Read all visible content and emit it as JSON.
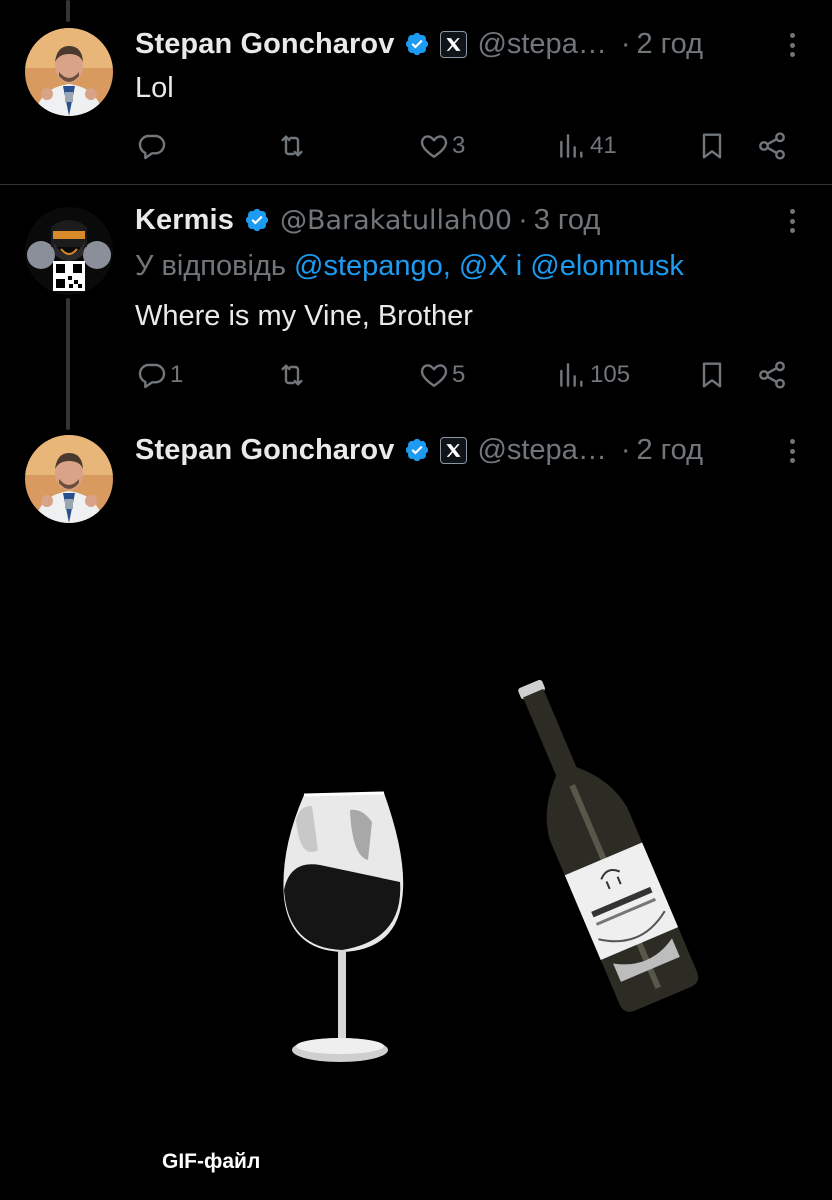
{
  "tweets": [
    {
      "name": "Stepan Goncharov",
      "handle": "@stepa…",
      "time": "2 год",
      "text": "Lol",
      "replies": "",
      "reposts": "",
      "likes": "3",
      "views": "41",
      "has_affiliate_badge": true
    },
    {
      "name": "Kermis",
      "handle": "@Barakatullah00",
      "time": "3 год",
      "reply_prefix": "У відповідь",
      "reply_mentions": "@stepango, @X",
      "reply_joiner": "i",
      "reply_last": "@elonmusk",
      "text": "Where is my Vine, Brother",
      "replies": "1",
      "reposts": "",
      "likes": "5",
      "views": "105"
    },
    {
      "name": "Stepan Goncharov",
      "handle": "@stepa…",
      "time": "2 год",
      "media_badge": "GIF-файл",
      "has_affiliate_badge": true
    }
  ],
  "separator": "·",
  "icons": {
    "verified": "verified-badge-icon",
    "affiliate": "x-affiliate-icon",
    "reply": "reply-icon",
    "repost": "repost-icon",
    "like": "heart-icon",
    "views": "views-icon",
    "bookmark": "bookmark-icon",
    "share": "share-icon",
    "more": "more-vertical-icon"
  },
  "colors": {
    "background": "#000000",
    "text": "#e7e9ea",
    "muted": "#71767b",
    "accent": "#1d9bf0"
  }
}
